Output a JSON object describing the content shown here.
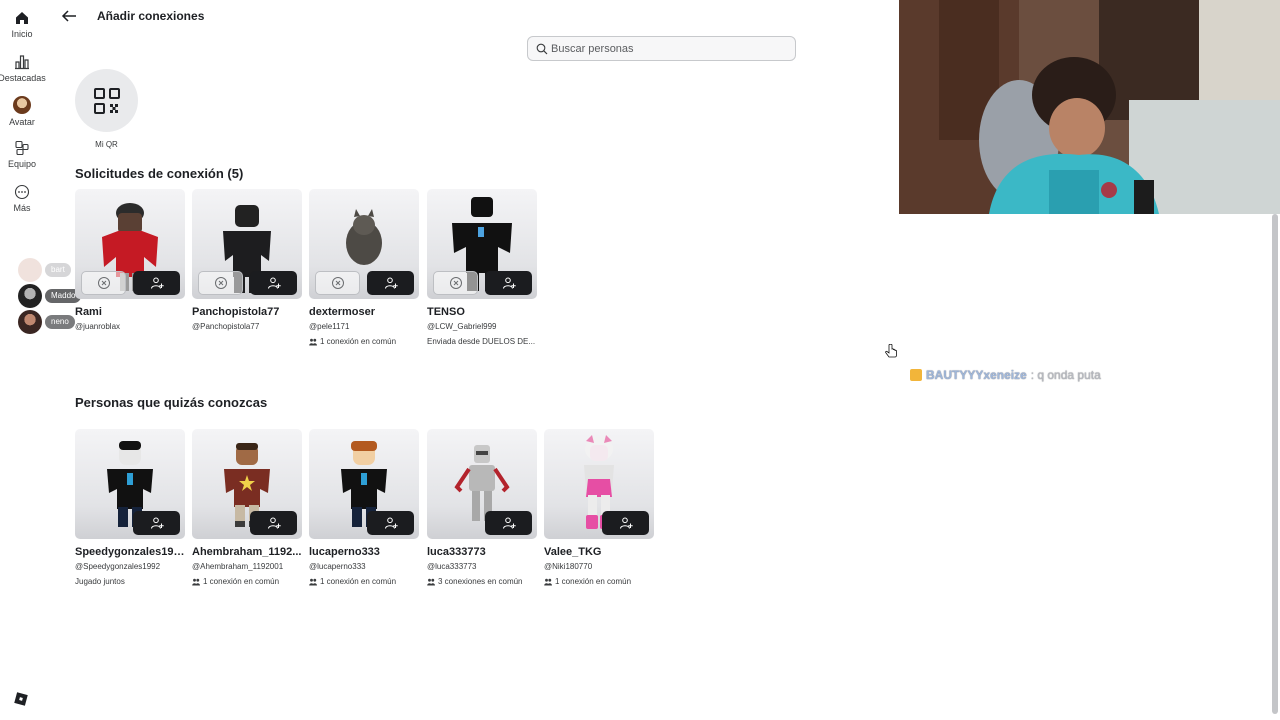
{
  "nav": [
    {
      "label": "Inicio",
      "icon": "home-icon"
    },
    {
      "label": "Destacadas",
      "icon": "chart-icon"
    },
    {
      "label": "Avatar",
      "icon": "avatar-icon"
    },
    {
      "label": "Equipo",
      "icon": "team-icon"
    },
    {
      "label": "Más",
      "icon": "more-icon"
    }
  ],
  "online_friends": [
    {
      "tag": "bart"
    },
    {
      "tag": "Maddo"
    },
    {
      "tag": "neno"
    }
  ],
  "header": {
    "title": "Añadir conexiones",
    "search_placeholder": "Buscar personas"
  },
  "qr": {
    "label": "Mi QR"
  },
  "requests": {
    "title": "Solicitudes de conexión (5)",
    "items": [
      {
        "name": "Rami",
        "handle": "@juanroblax",
        "meta": ""
      },
      {
        "name": "Panchopistola77",
        "handle": "@Panchopistola77",
        "meta": ""
      },
      {
        "name": "dextermoser",
        "handle": "@pele1171",
        "meta": "1 conexión en común"
      },
      {
        "name": "TENSO",
        "handle": "@LCW_Gabriel999",
        "meta": "Enviada desde DUELOS DE..."
      }
    ]
  },
  "suggestions": {
    "title": "Personas que quizás conozcas",
    "items": [
      {
        "name": "Speedygonzales1992",
        "handle": "@Speedygonzales1992",
        "meta": "Jugado juntos"
      },
      {
        "name": "Ahembraham_1192...",
        "handle": "@Ahembraham_1192001",
        "meta": "1 conexión en común"
      },
      {
        "name": "lucaperno333",
        "handle": "@lucaperno333",
        "meta": "1 conexión en común"
      },
      {
        "name": "luca333773",
        "handle": "@luca333773",
        "meta": "3 conexiones en común"
      },
      {
        "name": "Valee_TKG",
        "handle": "@Niki180770",
        "meta": "1 conexión en común"
      }
    ]
  },
  "overlay_chat": {
    "user": "BAUTYYYxeneize",
    "message": ": q onda puta"
  },
  "colors": {
    "accent_dark": "#1b1c1f",
    "thumb_bg": "#e2e3e6"
  }
}
